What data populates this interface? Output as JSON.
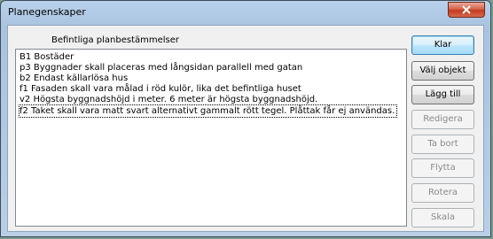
{
  "window": {
    "title": "Planegenskaper"
  },
  "list": {
    "label": "Befintliga planbestämmelser",
    "items": [
      "B1 Bostäder",
      "p3 Byggnader skall placeras med långsidan parallell med gatan",
      "b2 Endast källarlösa hus",
      "f1 Fasaden skall vara målad i röd kulör, lika det befintliga huset",
      "v2 Högsta byggnadshöjd i meter. 6 meter är högsta byggnadshöjd.",
      "f2 Taket skall vara matt svart alternativt gammalt rött tegel. Plåttak får ej användas."
    ],
    "focused_index": 5
  },
  "buttons": {
    "klar": "Klar",
    "valj_objekt": "Välj objekt",
    "lagg_till": "Lägg till",
    "redigera": "Redigera",
    "ta_bort": "Ta bort",
    "flytta": "Flytta",
    "rotera": "Rotera",
    "skala": "Skala"
  }
}
